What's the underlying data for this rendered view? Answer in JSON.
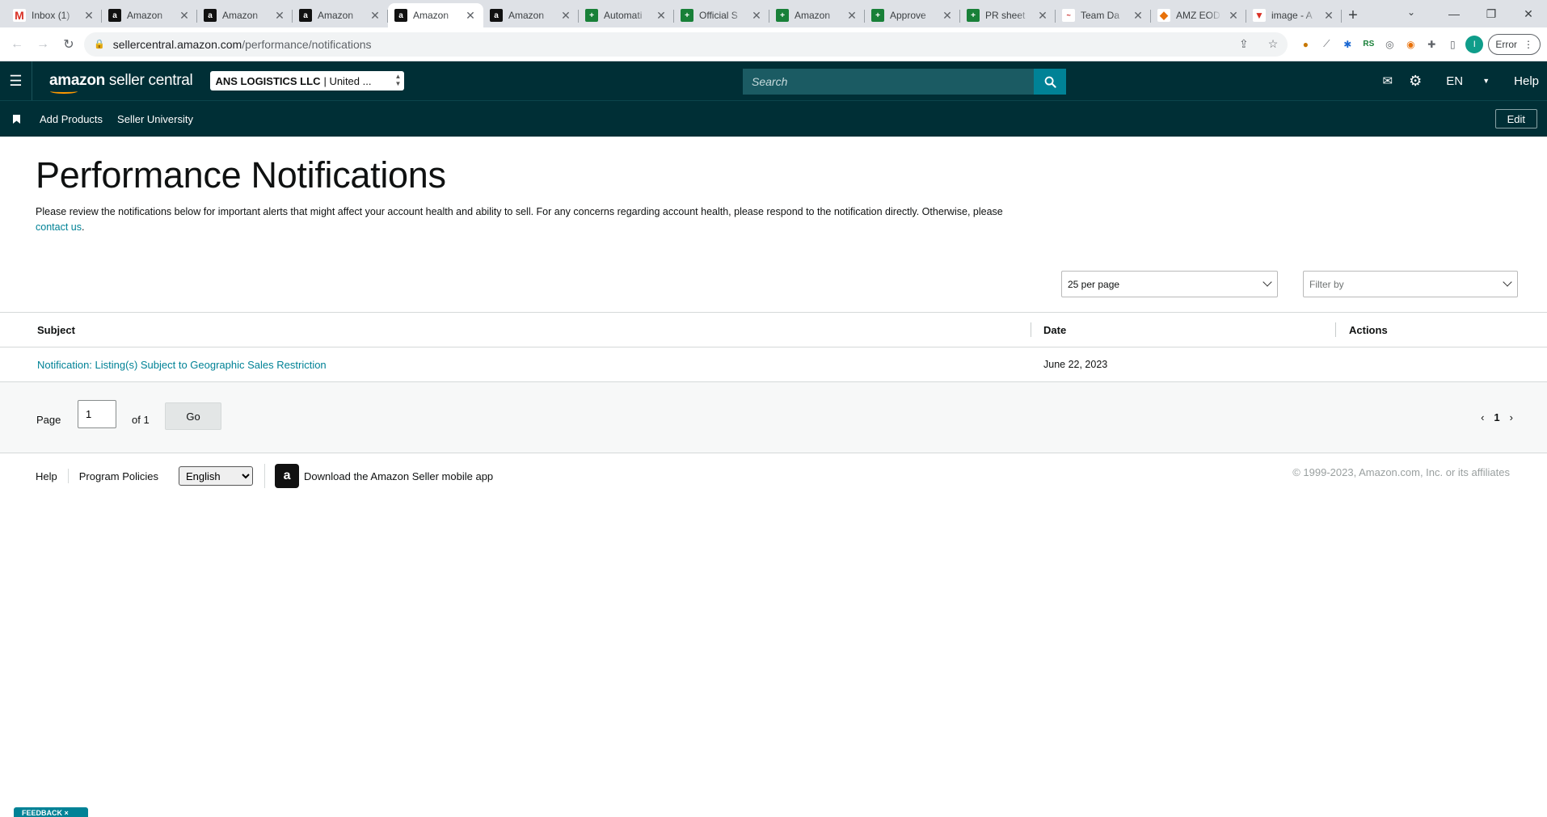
{
  "browser": {
    "tabs": [
      {
        "label": "Inbox (1)",
        "favicon": "gmail-icon",
        "glyph": "M"
      },
      {
        "label": "Amazon",
        "favicon": "amazon-icon",
        "glyph": "a"
      },
      {
        "label": "Amazon",
        "favicon": "amazon-icon",
        "glyph": "a"
      },
      {
        "label": "Amazon",
        "favicon": "amazon-icon",
        "glyph": "a"
      },
      {
        "label": "Amazon",
        "favicon": "amazon-icon",
        "glyph": "a",
        "active": true
      },
      {
        "label": "Amazon",
        "favicon": "amazon-icon",
        "glyph": "a"
      },
      {
        "label": "Automati",
        "favicon": "sheets-icon",
        "glyph": "+"
      },
      {
        "label": "Official S",
        "favicon": "sheets-icon",
        "glyph": "+"
      },
      {
        "label": "Amazon",
        "favicon": "sheets-icon",
        "glyph": "+"
      },
      {
        "label": "Approve",
        "favicon": "sheets-icon",
        "glyph": "+"
      },
      {
        "label": "PR sheet",
        "favicon": "sheets-icon",
        "glyph": "+"
      },
      {
        "label": "Team Da",
        "favicon": "team-icon",
        "glyph": "~"
      },
      {
        "label": "AMZ EOD",
        "favicon": "amz-eod-icon",
        "glyph": "◆"
      },
      {
        "label": "image - A",
        "favicon": "image-icon",
        "glyph": "▼"
      }
    ],
    "url_host": "sellercentral.amazon.com",
    "url_path": "/performance/notifications",
    "error_label": "Error",
    "profile_initial": "I"
  },
  "header": {
    "logo_bold": "amazon",
    "logo_rest": " seller central",
    "account_name": "ANS LOGISTICS LLC",
    "account_region": "| United ...",
    "search_placeholder": "Search",
    "language": "EN",
    "help": "Help"
  },
  "subnav": {
    "items": [
      "Add Products",
      "Seller University"
    ],
    "edit": "Edit"
  },
  "page": {
    "title": "Performance Notifications",
    "description": "Please review the notifications below for important alerts that might affect your account health and ability to sell. For any concerns regarding account health, please respond to the notification directly. Otherwise, please ",
    "contact_link": "contact us",
    "description_end": "."
  },
  "controls": {
    "per_page": "25 per page",
    "filter_placeholder": "Filter by"
  },
  "table": {
    "headers": {
      "subject": "Subject",
      "date": "Date",
      "actions": "Actions"
    },
    "rows": [
      {
        "subject": "Notification: Listing(s) Subject to Geographic Sales Restriction",
        "date": "June 22, 2023",
        "actions": ""
      }
    ]
  },
  "pager": {
    "page_label": "Page",
    "current_page": "1",
    "of_label": "of 1",
    "go": "Go",
    "page_number": "1"
  },
  "footer": {
    "help": "Help",
    "program_policies": "Program Policies",
    "language": "English",
    "app_text": "Download the Amazon Seller mobile app",
    "copyright": "© 1999-2023, Amazon.com, Inc. or its affiliates"
  },
  "feedback": "FEEDBACK ×",
  "colors": {
    "header_bg": "#002f36",
    "search_btn": "#008296",
    "link": "#008296",
    "accent_orange": "#ff9900"
  }
}
